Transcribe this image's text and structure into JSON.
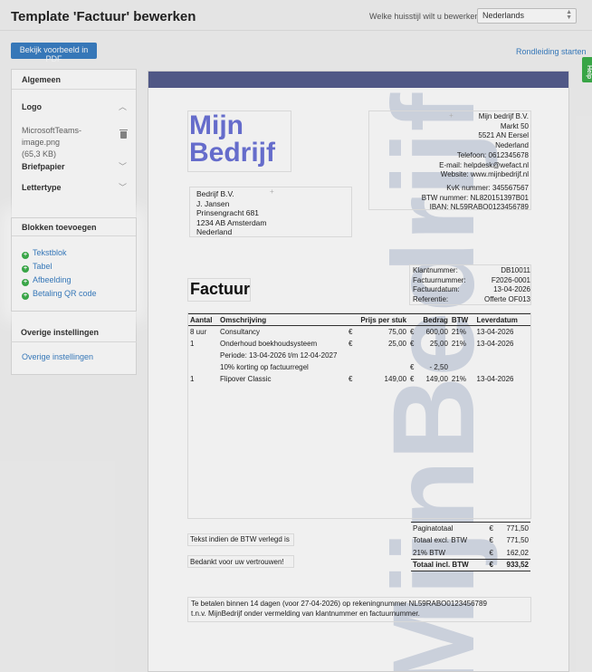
{
  "header": {
    "title": "Template 'Factuur' bewerken",
    "house_style_label": "Welke huisstijl wilt u bewerken?",
    "house_style_value": "Nederlands"
  },
  "toolbar": {
    "preview_pdf_label": "Bekijk voorbeeld in PDF",
    "tour_label": "Rondleiding starten",
    "help_label": "Help"
  },
  "sidebar": {
    "general": "Algemeen",
    "logo": "Logo",
    "logo_file_name": "MicrosoftTeams-image.png",
    "logo_file_size": "(65,3 KB)",
    "letterhead": "Briefpapier",
    "font": "Lettertype",
    "blocks_title": "Blokken toevoegen",
    "blocks": [
      "Tekstblok",
      "Tabel",
      "Afbeelding",
      "Betaling QR code"
    ],
    "other_title": "Overige instellingen",
    "other_link": "Overige instellingen"
  },
  "invoice": {
    "logo_line1": "Mijn",
    "logo_line2": "Bedrijf",
    "watermark": "MijnBedrijf",
    "company": {
      "name": "Mijn bedrijf B.V.",
      "street": "Markt 50",
      "city": "5521 AN Eersel",
      "country": "Nederland",
      "phone": "Telefoon: 0612345678",
      "email": "E-mail: helpdesk@wefact.nl",
      "website": "Website: www.mijnbedrijf.nl",
      "kvk": "KvK nummer: 345567567",
      "vat": "BTW nummer: NL820151397B01",
      "iban": "IBAN: NL59RABO0123456789"
    },
    "customer": {
      "name": "Bedrijf B.V.",
      "contact": "J. Jansen",
      "street": "Prinsengracht 681",
      "city": "1234 AB Amsterdam",
      "country": "Nederland"
    },
    "meta": {
      "customer_no_label": "Klantnummer:",
      "customer_no": "DB10011",
      "invoice_no_label": "Factuurnummer:",
      "invoice_no": "F2026-0001",
      "date_label": "Factuurdatum:",
      "date": "13-04-2026",
      "reference_label": "Referentie:",
      "reference": "Offerte OF013"
    },
    "title": "Factuur",
    "columns": [
      "Aantal",
      "Omschrijving",
      "Prijs per stuk",
      "Bedrag",
      "BTW",
      "Leverdatum"
    ],
    "rows": [
      {
        "qty": "8 uur",
        "desc": "Consultancy",
        "cur1": "€",
        "price": "75,00",
        "cur2": "€",
        "amount": "600,00",
        "vat": "21%",
        "date": "13-04-2026"
      },
      {
        "qty": "1",
        "desc": "Onderhoud boekhoudsysteem",
        "cur1": "€",
        "price": "25,00",
        "cur2": "€",
        "amount": "25,00",
        "vat": "21%",
        "date": "13-04-2026"
      },
      {
        "qty": "",
        "desc": "Periode: 13-04-2026 t/m 12-04-2027",
        "cur1": "",
        "price": "",
        "cur2": "",
        "amount": "",
        "vat": "",
        "date": ""
      },
      {
        "qty": "",
        "desc": "10% korting op factuurregel",
        "cur1": "",
        "price": "",
        "cur2": "€",
        "amount": "- 2,50",
        "vat": "",
        "date": ""
      },
      {
        "qty": "1",
        "desc": "Flipover Classic",
        "cur1": "€",
        "price": "149,00",
        "cur2": "€",
        "amount": "149,00",
        "vat": "21%",
        "date": "13-04-2026"
      }
    ],
    "note_vat": "Tekst indien de BTW verlegd is",
    "note_thanks": "Bedankt voor uw vertrouwen!",
    "totals": [
      {
        "label": "Paginatotaal",
        "cur": "€",
        "value": "771,50"
      },
      {
        "label": "Totaal excl. BTW",
        "cur": "€",
        "value": "771,50"
      },
      {
        "label": "21% BTW",
        "cur": "€",
        "value": "162,02"
      },
      {
        "label": "Totaal incl. BTW",
        "cur": "€",
        "value": "933,52"
      }
    ],
    "payment_line1": "Te betalen binnen 14 dagen (voor 27-04-2026) op rekeningnummer NL59RABO0123456789",
    "payment_line2": "t.n.v. MijnBedrijf onder vermelding van klantnummer en factuurnummer."
  },
  "colors": {
    "primary": "#3a7fc4",
    "success": "#3cb04b",
    "invoice_bar": "#555e8f",
    "logo": "#6c73d8"
  }
}
